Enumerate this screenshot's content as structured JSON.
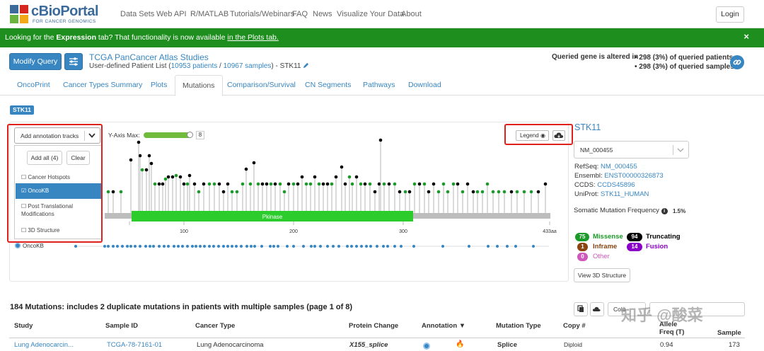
{
  "header": {
    "logo_text": "cBioPortal",
    "logo_sub": "FOR CANCER GENOMICS",
    "nav": [
      "Data Sets",
      "Web API",
      "R/MATLAB",
      "Tutorials/Webinars",
      "FAQ",
      "News",
      "Visualize Your Data",
      "About"
    ],
    "login": "Login"
  },
  "banner": {
    "prefix": "Looking for the ",
    "bold": "Expression",
    "middle": " tab? That functionality is now available ",
    "link": "in the Plots tab.",
    "close": "×",
    "color": "#1e8f1e"
  },
  "query": {
    "modify": "Modify Query",
    "study_title": "TCGA PanCancer Atlas Studies",
    "sub_prefix": "User-defined Patient List (",
    "patients": "10953 patients",
    "sep": " / ",
    "samples": "10967 samples",
    "sub_suffix": ")  - STK11",
    "altered_label": "Queried gene is altered in",
    "altered_patients": "• 298 (3%) of queried patients",
    "altered_samples": "• 298 (3%) of queried samples"
  },
  "tabs": [
    "OncoPrint",
    "Cancer Types Summary",
    "Plots",
    "Mutations",
    "Comparison/Survival",
    "CN Segments",
    "Pathways",
    "Download"
  ],
  "active_tab": "Mutations",
  "gene_badge": "STK11",
  "plot": {
    "annotation_dropdown": "Add annotation tracks",
    "add_all": "Add all (4)",
    "clear": "Clear",
    "menu_items": [
      "Cancer Hotspots",
      "OncoKB",
      "Post Translational Modifications",
      "3D Structure"
    ],
    "selected_item": "OncoKB",
    "ymax_label": "Y-Axis Max:",
    "ymax_value": "8",
    "ymax_fraction": 1.0,
    "legend": "Legend",
    "domain_label": "Pkinase",
    "axis_ticks": [
      "100",
      "200",
      "300",
      "433aa"
    ],
    "oncokb_track": "OncoKB"
  },
  "side": {
    "gene": "STK11",
    "transcript": "NM_000455",
    "refseq_label": "RefSeq:",
    "refseq": "NM_000455",
    "ensembl_label": "Ensembl:",
    "ensembl": "ENST00000326873",
    "ccds_label": "CCDS:",
    "ccds": "CCDS45896",
    "uniprot_label": "UniProt:",
    "uniprot": "STK11_HUMAN",
    "smf_label": "Somatic Mutation Frequency",
    "smf_value": "1.5%",
    "counts": {
      "missense": {
        "n": "75",
        "label": "Missense",
        "color": "#1a9a28"
      },
      "truncating": {
        "n": "94",
        "label": "Truncating",
        "color": "#000000"
      },
      "inframe": {
        "n": "1",
        "label": "Inframe",
        "color": "#8b4513"
      },
      "fusion": {
        "n": "14",
        "label": "Fusion",
        "color": "#8b00c9"
      },
      "other": {
        "n": "0",
        "label": "Other",
        "color": "#cf58bc"
      }
    },
    "view3d": "View 3D Structure"
  },
  "table": {
    "title": "184 Mutations: includes 2 duplicate mutations in patients with multiple samples (page 1 of 8)",
    "columns_btn": "Colu",
    "headers": [
      "Study",
      "Sample ID",
      "Cancer Type",
      "Protein Change",
      "Annotation ▼",
      "Mutation Type",
      "Copy #",
      "Allele",
      "Freq (T)",
      "Sample"
    ],
    "row": [
      "Lung Adenocarcin...",
      "TCGA-78-7161-01",
      "Lung Adenocarcinoma",
      "X155_splice",
      "Splice",
      "Diploid",
      "0.94",
      "173"
    ]
  },
  "watermark": "知乎 @酸菜"
}
